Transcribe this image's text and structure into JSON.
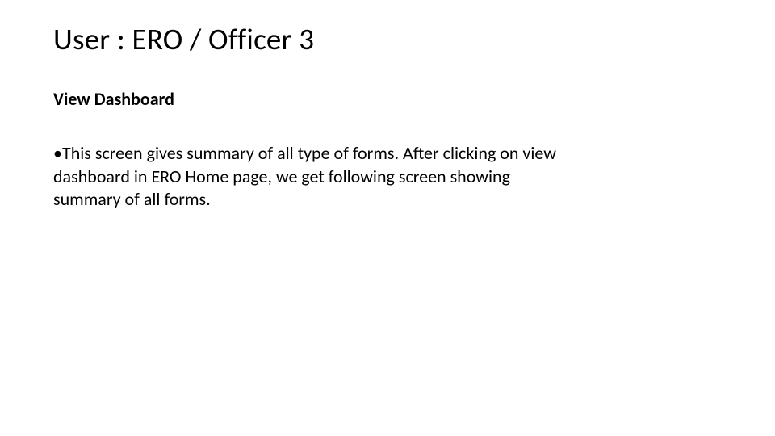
{
  "title": "User : ERO / Officer 3",
  "subtitle": "View Dashboard",
  "bullet": {
    "mark": "•",
    "text": "This screen gives summary of all type of forms. After clicking on view dashboard in ERO Home page, we get following screen showing summary of all forms."
  }
}
